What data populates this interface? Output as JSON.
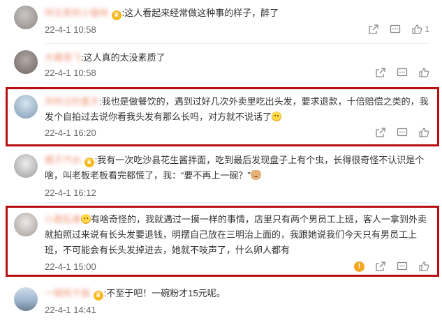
{
  "comments": [
    {
      "username": "阿北家的小猫咪",
      "badge": "gold",
      "text": ":这人看起来经常做这种事的样子，醉了",
      "time": "22-4-1 10:58",
      "likes": "1"
    },
    {
      "username": "大雁南飞",
      "badge": "",
      "text": ":这人真的太没素质了",
      "time": "22-4-1 10:58",
      "likes": ""
    },
    {
      "username": "风吹过的夏天",
      "badge": "",
      "text": ":我也是做餐饮的，遇到过好几次外卖里吃出头发，要求退款，十倍赔偿之类的，我发个自拍过去说你看我头发有那么长吗，对方就不说话了",
      "time": "22-4-1 16:20",
      "likes": ""
    },
    {
      "username": "橘子汽水",
      "badge": "gold",
      "text": ":我有一次吃沙县花生酱拌面，吃到最后发现盘子上有个虫，长得很奇怪不认识是个啥，叫老板老板看完都慌了，我：“要不再上一碗？”",
      "time": "22-4-1 16:12",
      "likes": ""
    },
    {
      "username": "小鹿乱撞",
      "badge": "face",
      "text": "有啥奇怪的，我就遇过一摸一样的事情，店里只有两个男员工上班，客人一拿到外卖就拍照过来说有长头发要退钱，明摆自己放在三明治上面的，我跟她说我们今天只有男员工上班，不可能会有长头发掉进去，她就不吱声了，什么卵人都有",
      "time": "22-4-1 15:00",
      "likes": ""
    },
    {
      "username": "一碗热干面",
      "badge": "gold",
      "text": ":不至于吧！一碗粉才15元呢。",
      "time": "22-4-1 14:41",
      "likes": ""
    }
  ],
  "colors": {
    "highlight": "#b90f12",
    "username": "#eb7350"
  }
}
